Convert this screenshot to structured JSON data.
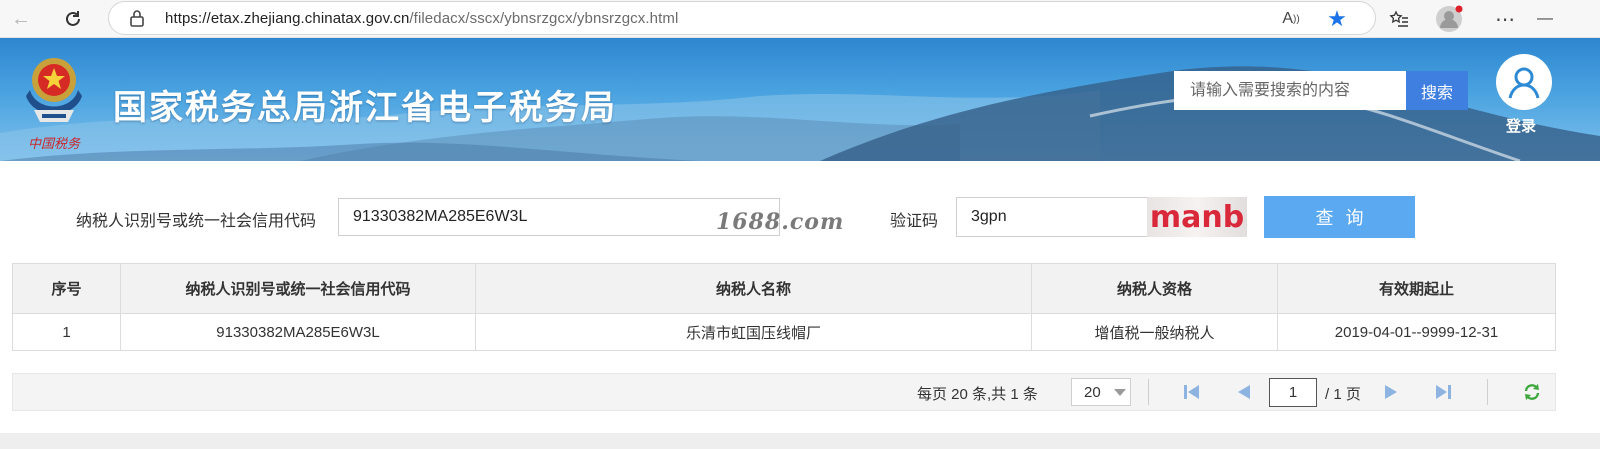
{
  "browser": {
    "url_host": "https://etax.zhejiang.chinatax.gov.cn",
    "url_path": "/filedacx/sscx/ybnsrzgcx/ybnsrzgcx.html"
  },
  "header": {
    "title": "国家税务总局浙江省电子税务局",
    "search_placeholder": "请输入需要搜索的内容",
    "search_button": "搜索",
    "login_label": "登录",
    "emblem_caption": "中国税务"
  },
  "form": {
    "taxpayer_id_label": "纳税人识别号或统一社会信用代码",
    "taxpayer_id_value": "91330382MA285E6W3L",
    "captcha_label": "验证码",
    "captcha_value": "3gpn",
    "captcha_image_text": "manb",
    "query_button": "查询",
    "watermark": "1688.com"
  },
  "table": {
    "headers": [
      "序号",
      "纳税人识别号或统一社会信用代码",
      "纳税人名称",
      "纳税人资格",
      "有效期起止"
    ],
    "rows": [
      [
        "1",
        "91330382MA285E6W3L",
        "乐清市虹国压线帽厂",
        "增值税一般纳税人",
        "2019-04-01--9999-12-31"
      ]
    ]
  },
  "pager": {
    "summary": "每页 20 条,共 1 条",
    "page_size": "20",
    "current_page": "1",
    "total_pages": "/ 1 页"
  },
  "colors": {
    "accent": "#3f7fe0",
    "query_button": "#5ba9f0",
    "banner": "#3a95da"
  }
}
